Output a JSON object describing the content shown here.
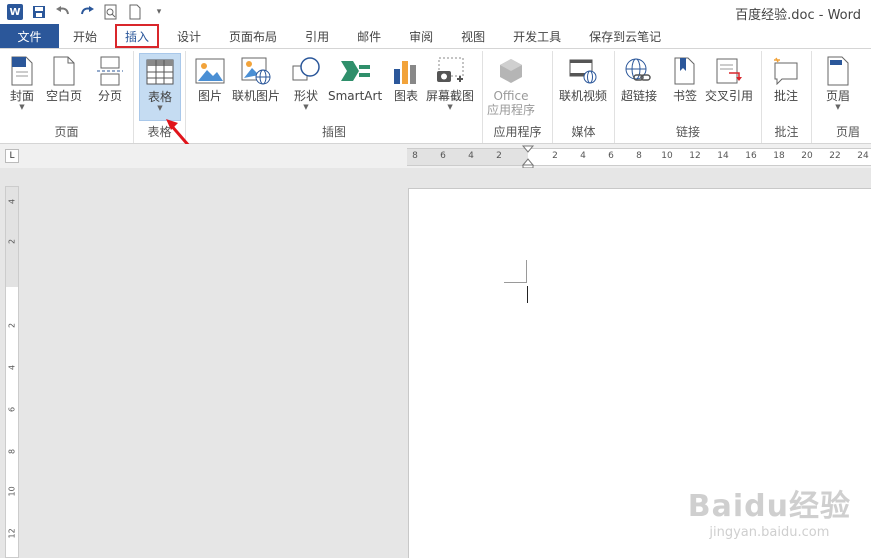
{
  "window": {
    "title": "百度经验.doc - Word"
  },
  "qat": {
    "icons": [
      "word-logo-icon",
      "save-icon",
      "undo-icon",
      "redo-icon",
      "print-preview-icon",
      "new-doc-icon",
      "customize-icon"
    ]
  },
  "tabs": [
    {
      "label": "文件"
    },
    {
      "label": "开始"
    },
    {
      "label": "插入"
    },
    {
      "label": "设计"
    },
    {
      "label": "页面布局"
    },
    {
      "label": "引用"
    },
    {
      "label": "邮件"
    },
    {
      "label": "审阅"
    },
    {
      "label": "视图"
    },
    {
      "label": "开发工具"
    },
    {
      "label": "保存到云笔记"
    }
  ],
  "groups": {
    "pages": {
      "label": "页面",
      "cover": "封面",
      "blank": "空白页",
      "break": "分页"
    },
    "tables": {
      "label": "表格",
      "table": "表格"
    },
    "illustrations": {
      "label": "插图",
      "picture": "图片",
      "online_picture": "联机图片",
      "shapes": "形状",
      "smartart": "SmartArt",
      "chart": "图表",
      "screenshot": "屏幕截图"
    },
    "apps": {
      "label": "应用程序",
      "office": "Office",
      "apps": "应用程序"
    },
    "media": {
      "label": "媒体",
      "online_video": "联机视频"
    },
    "links": {
      "label": "链接",
      "hyperlink": "超链接",
      "bookmark": "书签",
      "cross_ref": "交叉引用"
    },
    "comments": {
      "label": "批注",
      "comment": "批注"
    },
    "header": {
      "label": "页眉",
      "header": "页眉"
    }
  },
  "ruler": {
    "h_labels": [
      "8",
      "6",
      "4",
      "2",
      "2",
      "4",
      "6",
      "8",
      "10",
      "12",
      "14",
      "16",
      "18",
      "20",
      "22",
      "24"
    ],
    "v_labels": [
      "4",
      "2",
      "2",
      "4",
      "6",
      "8",
      "10",
      "12"
    ],
    "tab_selector": "L"
  },
  "watermark": {
    "brand": "Baidu经验",
    "url": "jingyan.baidu.com"
  },
  "colors": {
    "accent": "#2b579a",
    "highlight_box": "#d9262b",
    "selected_button": "#c5dcf2"
  }
}
